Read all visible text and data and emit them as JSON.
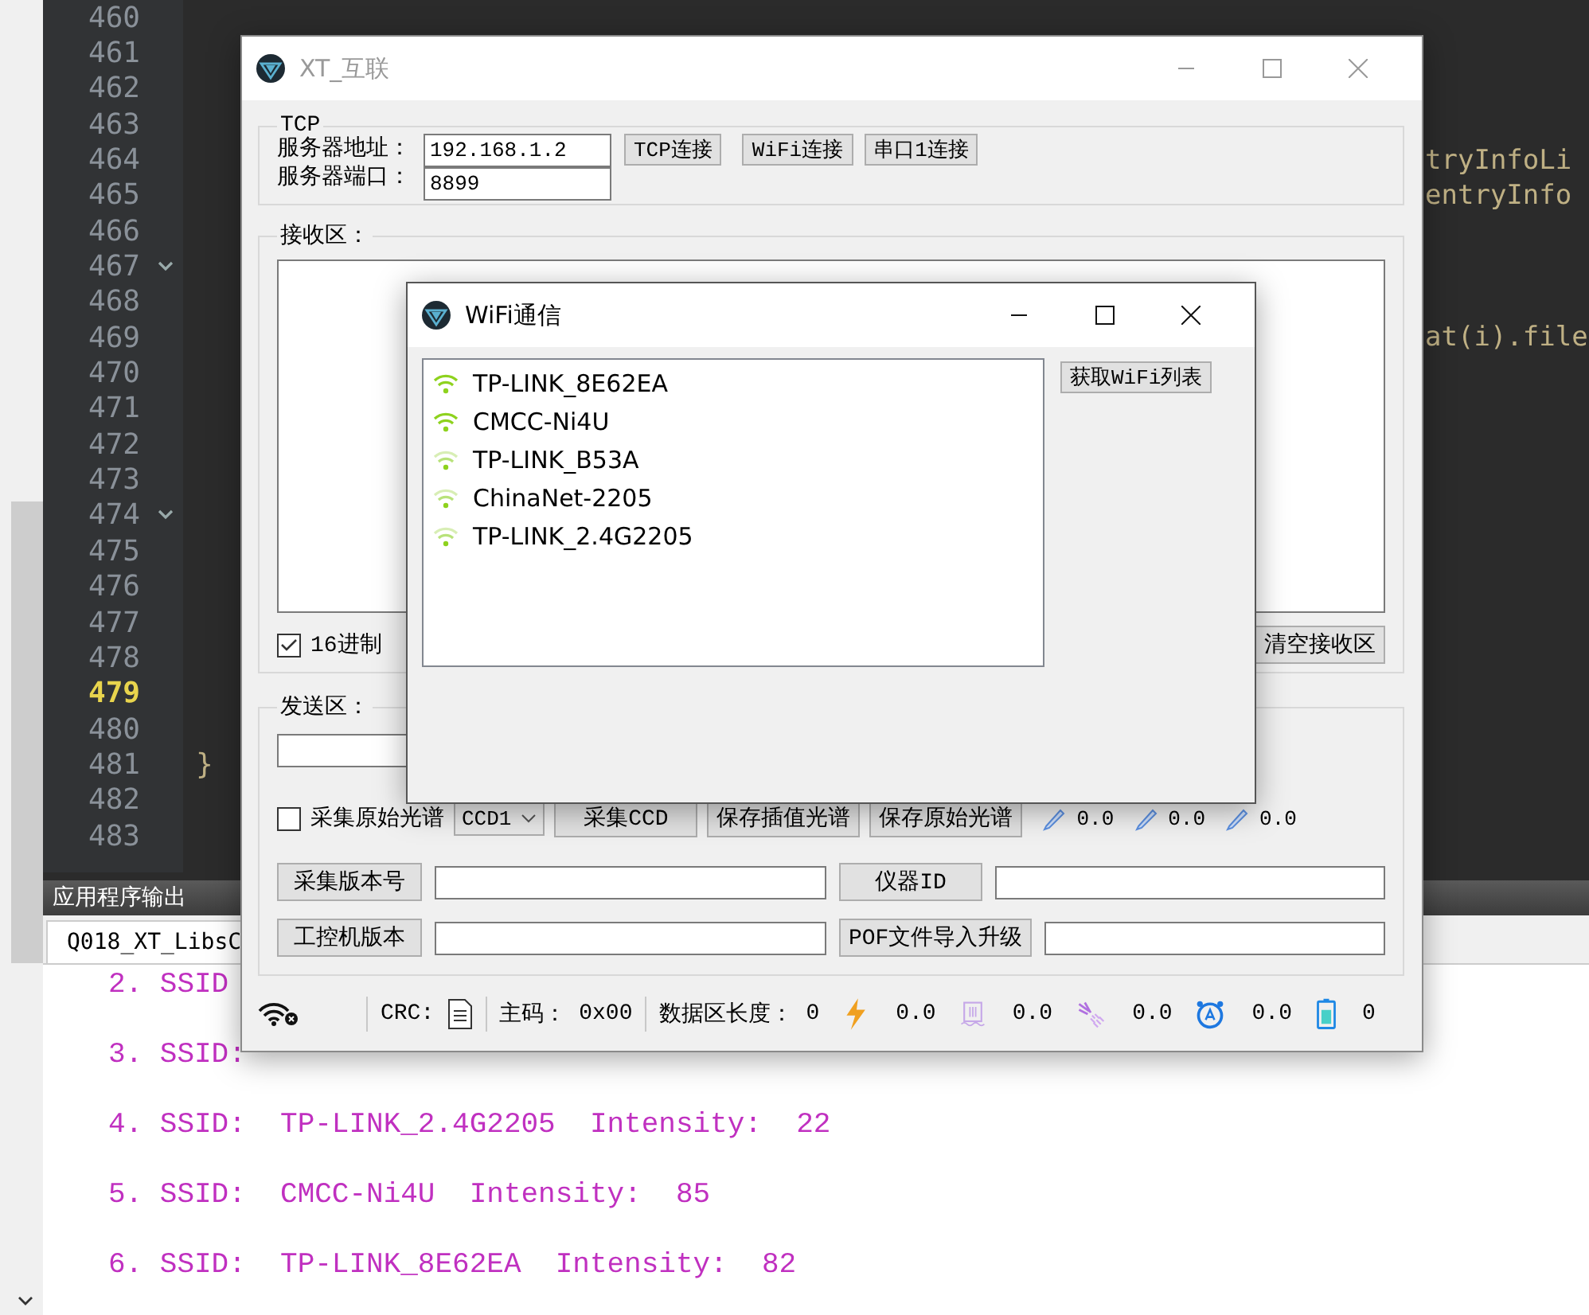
{
  "editor": {
    "lines": [
      {
        "number": "460",
        "fold": false,
        "current": false
      },
      {
        "number": "461",
        "fold": false,
        "current": false
      },
      {
        "number": "462",
        "fold": false,
        "current": false
      },
      {
        "number": "463",
        "fold": false,
        "current": false
      },
      {
        "number": "464",
        "fold": false,
        "current": false,
        "code": "tryInfoLi",
        "kind": "right"
      },
      {
        "number": "465",
        "fold": false,
        "current": false,
        "code": "entryInfo",
        "kind": "right"
      },
      {
        "number": "466",
        "fold": false,
        "current": false
      },
      {
        "number": "467",
        "fold": true,
        "current": false
      },
      {
        "number": "468",
        "fold": false,
        "current": false
      },
      {
        "number": "469",
        "fold": false,
        "current": false,
        "code": "at(i).file",
        "kind": "right"
      },
      {
        "number": "470",
        "fold": false,
        "current": false
      },
      {
        "number": "471",
        "fold": false,
        "current": false
      },
      {
        "number": "472",
        "fold": false,
        "current": false
      },
      {
        "number": "473",
        "fold": false,
        "current": false
      },
      {
        "number": "474",
        "fold": true,
        "current": false
      },
      {
        "number": "475",
        "fold": false,
        "current": false
      },
      {
        "number": "476",
        "fold": false,
        "current": false
      },
      {
        "number": "477",
        "fold": false,
        "current": false
      },
      {
        "number": "478",
        "fold": false,
        "current": false
      },
      {
        "number": "479",
        "fold": false,
        "current": true
      },
      {
        "number": "480",
        "fold": false,
        "current": false
      },
      {
        "number": "481",
        "fold": false,
        "current": false,
        "code": "}",
        "kind": "left"
      },
      {
        "number": "482",
        "fold": false,
        "current": false
      },
      {
        "number": "483",
        "fold": false,
        "current": false
      }
    ]
  },
  "output": {
    "title": "应用程序输出",
    "tab": "Q018_XT_LibsC",
    "lines": [
      "2. SSID",
      "3. SSID:",
      "4. SSID:  TP-LINK_2.4G2205  Intensity:  22",
      "5. SSID:  CMCC-Ni4U  Intensity:  85",
      "6. SSID:  TP-LINK_8E62EA  Intensity:  82"
    ]
  },
  "main_window": {
    "title": "XT_互联",
    "tcp": {
      "legend": "TCP",
      "address_label": "服务器地址：",
      "address": "192.168.1.2",
      "port_label": "服务器端口：",
      "port": "8899",
      "buttons": [
        "TCP连接",
        "WiFi连接",
        "串口1连接"
      ]
    },
    "receive": {
      "legend": "接收区：",
      "hex": {
        "label": "16进制",
        "checked": true
      },
      "clear_button": "清空接收区"
    },
    "send": {
      "legend": "发送区：",
      "raw": {
        "label": "采集原始光谱",
        "checked": false
      },
      "ccd_select": "CCD1",
      "buttons": [
        "采集CCD",
        "保存插值光谱",
        "保存原始光谱"
      ],
      "readings": [
        "0.0",
        "0.0",
        "0.0"
      ],
      "info_rows": [
        {
          "button": "采集版本号",
          "button2": "仪器ID"
        },
        {
          "button": "工控机版本",
          "button2": "POF文件导入升级"
        }
      ]
    },
    "status_bar": {
      "crc_label": "CRC:",
      "code_label": "主码：",
      "code": "0x00",
      "length_label": "数据区长度：",
      "length": "0",
      "gauges": [
        {
          "kind": "bolt",
          "value": "0.0"
        },
        {
          "kind": "tank",
          "value": "0.0"
        },
        {
          "kind": "spray",
          "value": "0.0"
        },
        {
          "kind": "alarm",
          "value": "0.0"
        },
        {
          "kind": "battery",
          "value": "0"
        }
      ]
    }
  },
  "wifi_dialog": {
    "title": "WiFi通信",
    "networks": [
      {
        "name": "TP-LINK_8E62EA",
        "kind": "strong"
      },
      {
        "name": "CMCC-Ni4U",
        "kind": "strong"
      },
      {
        "name": "TP-LINK_B53A",
        "kind": "weak"
      },
      {
        "name": "ChinaNet-2205",
        "kind": "weak"
      },
      {
        "name": "TP-LINK_2.4G2205",
        "kind": "weak"
      }
    ],
    "refresh_button": "获取WiFi列表"
  }
}
